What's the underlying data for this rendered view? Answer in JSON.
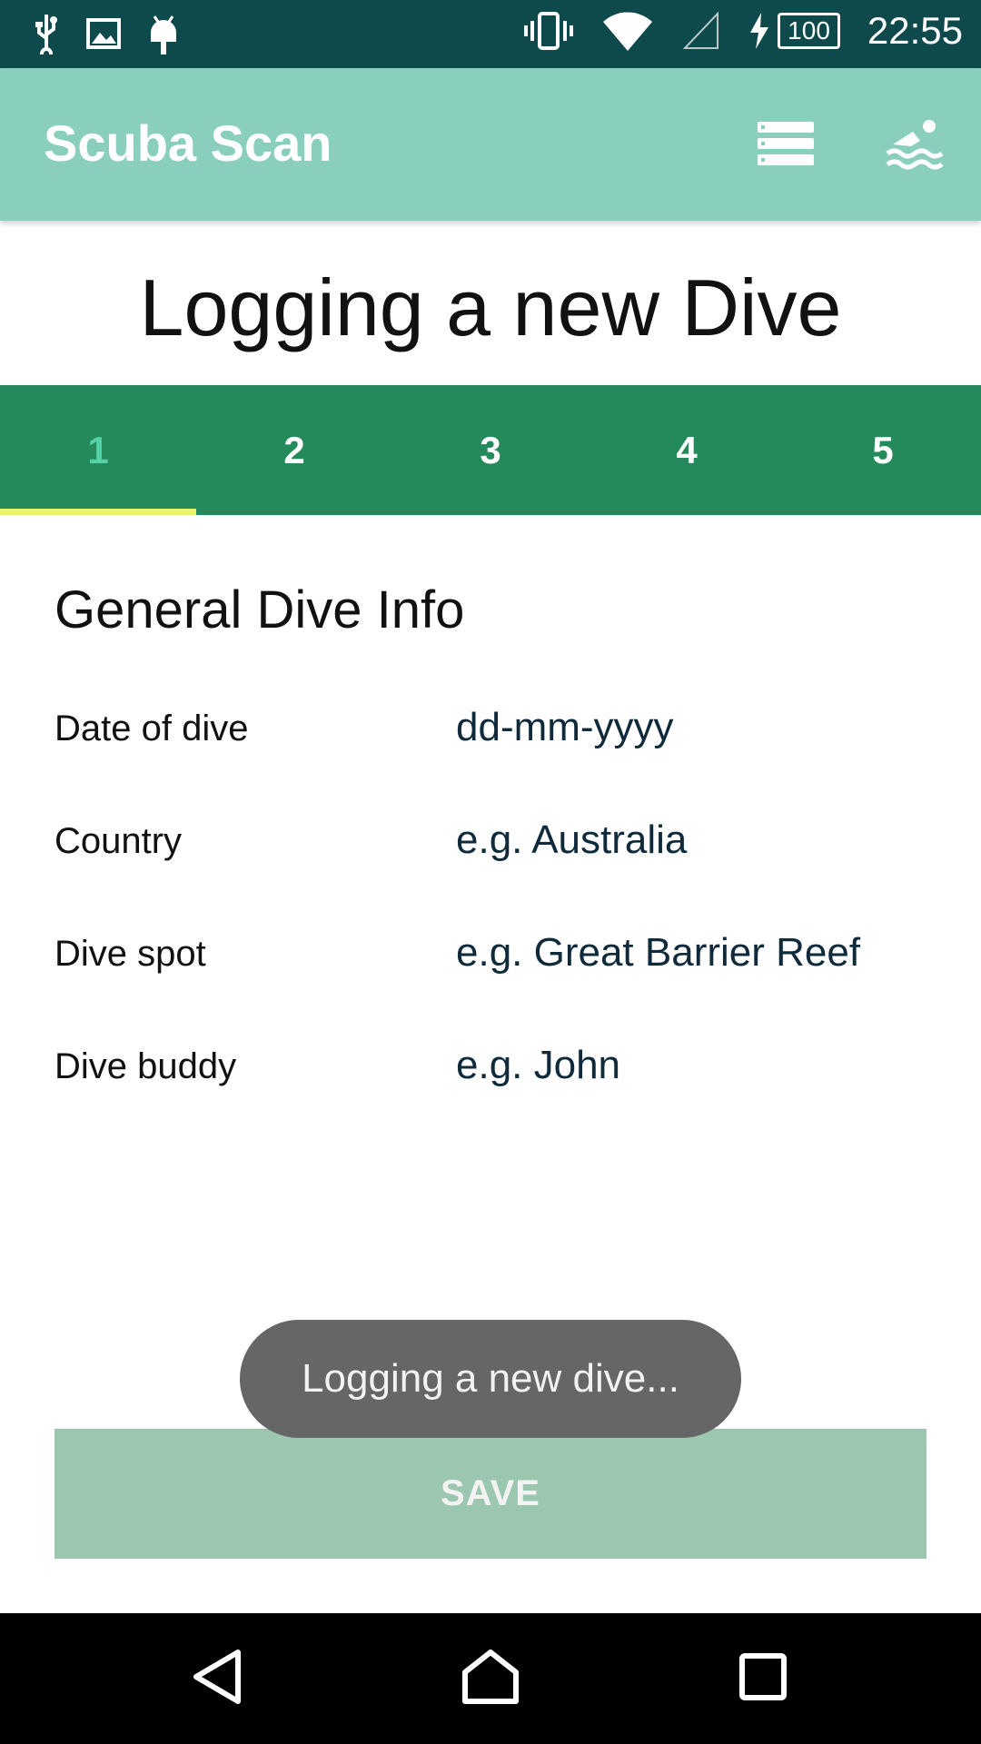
{
  "status_bar": {
    "battery_level": "100",
    "time": "22:55",
    "icons": [
      "usb-icon",
      "image-icon",
      "android-icon",
      "vibrate-icon",
      "wifi-icon",
      "signal-icon",
      "charging-icon",
      "battery-icon"
    ]
  },
  "app_bar": {
    "title": "Scuba Scan",
    "actions": [
      "list-icon",
      "swimmer-icon"
    ]
  },
  "page": {
    "title": "Logging a new Dive"
  },
  "tabs": [
    {
      "label": "1",
      "active": true
    },
    {
      "label": "2",
      "active": false
    },
    {
      "label": "3",
      "active": false
    },
    {
      "label": "4",
      "active": false
    },
    {
      "label": "5",
      "active": false
    }
  ],
  "form": {
    "section_title": "General Dive Info",
    "fields": [
      {
        "label": "Date of dive",
        "placeholder": "dd-mm-yyyy"
      },
      {
        "label": "Country",
        "placeholder": "e.g. Australia"
      },
      {
        "label": "Dive spot",
        "placeholder": "e.g. Great Barrier Reef"
      },
      {
        "label": "Dive buddy",
        "placeholder": "e.g. John"
      }
    ]
  },
  "toast": {
    "message": "Logging a new dive..."
  },
  "save_button": {
    "label": "SAVE"
  },
  "nav_bar": {
    "buttons": [
      "back-icon",
      "home-icon",
      "recents-icon"
    ]
  },
  "colors": {
    "status_bar": "#0e4a4c",
    "app_bar": "#8acfbe",
    "tabs_bg": "#248a5b",
    "active_tab_text": "#55d2a8",
    "tab_indicator": "#e8f56a",
    "save_button": "#9bc6b0",
    "toast": "#666666"
  }
}
